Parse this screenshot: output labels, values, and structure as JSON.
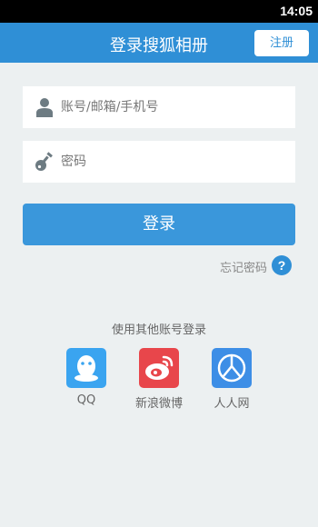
{
  "statusbar": {
    "time": "14:05"
  },
  "header": {
    "title": "登录搜狐相册",
    "register_label": "注册"
  },
  "form": {
    "account_placeholder": "账号/邮箱/手机号",
    "password_placeholder": "密码",
    "login_label": "登录",
    "forgot_label": "忘记密码",
    "help_glyph": "?"
  },
  "other": {
    "title": "使用其他账号登录",
    "providers": [
      {
        "label": "QQ",
        "icon": "qq-icon",
        "color": "#3aa4f0"
      },
      {
        "label": "新浪微博",
        "icon": "weibo-icon",
        "color": "#e8464b"
      },
      {
        "label": "人人网",
        "icon": "renren-icon",
        "color": "#3d8ee6"
      }
    ]
  },
  "colors": {
    "accent": "#2f8fd6",
    "button": "#3a97db",
    "background": "#ecf0f1"
  }
}
